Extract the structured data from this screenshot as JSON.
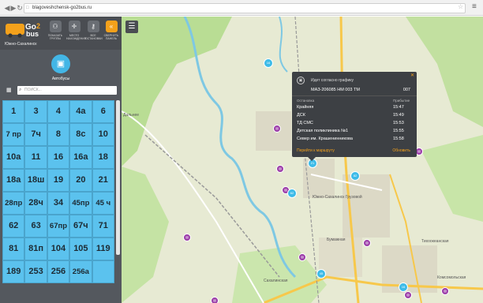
{
  "browser": {
    "url": "blagoveshchensk-go2bus.ru"
  },
  "sidebar": {
    "city": "Южно-Сахалинск",
    "tools": [
      {
        "label": "ПОКАЗАТЬ ГРУППЫ",
        "icon": "group-icon"
      },
      {
        "label": "МЕСТО НАХОЖДЕНИЯ",
        "icon": "location-icon"
      },
      {
        "label": "ВСЕ ОСТАНОВКИ",
        "icon": "key-icon"
      },
      {
        "label": "СВЕРНУТЬ ПАНЕЛЬ",
        "icon": "collapse-icon"
      }
    ],
    "transport_label": "Автобусы",
    "search_placeholder": "ПОИСК...",
    "routes": [
      "1",
      "3",
      "4",
      "4а",
      "6",
      "7 пр",
      "7ч",
      "8",
      "8с",
      "10",
      "10а",
      "11",
      "16",
      "16а",
      "18",
      "18а",
      "18ш",
      "19",
      "20",
      "21",
      "28пр",
      "28ч",
      "34",
      "45пр",
      "45 ч",
      "62",
      "63",
      "67пр",
      "67ч",
      "71",
      "81",
      "81п",
      "104",
      "105",
      "119",
      "189",
      "253",
      "256",
      "256а",
      ""
    ]
  },
  "map": {
    "labels": [
      {
        "text": "Дальнее"
      },
      {
        "text": "Южно-Сахалинск Грузовой"
      },
      {
        "text": "Бумажная"
      },
      {
        "text": "Сахалинская"
      },
      {
        "text": "Тихоокеанская"
      },
      {
        "text": "Комсомольская"
      }
    ],
    "bus_markers": [
      "16",
      "21",
      "62",
      "82",
      "45",
      "16"
    ]
  },
  "popup": {
    "title": "Идет согласно графику",
    "vehicle": "МАЗ-206085 НМ 003 ТМ",
    "vehicle_number": "007",
    "col_stop": "Остановка",
    "col_arrival": "Прибытие",
    "stops": [
      {
        "name": "Крайняя",
        "time": "15:47"
      },
      {
        "name": "ДСК",
        "time": "15:49"
      },
      {
        "name": "ТД СМС",
        "time": "15:53"
      },
      {
        "name": "Детская поликлиника №1",
        "time": "15:55"
      },
      {
        "name": "Север им. Крашенинникова",
        "time": "15:58"
      }
    ],
    "link": "Перейти к маршруту",
    "refresh": "Обновить"
  }
}
